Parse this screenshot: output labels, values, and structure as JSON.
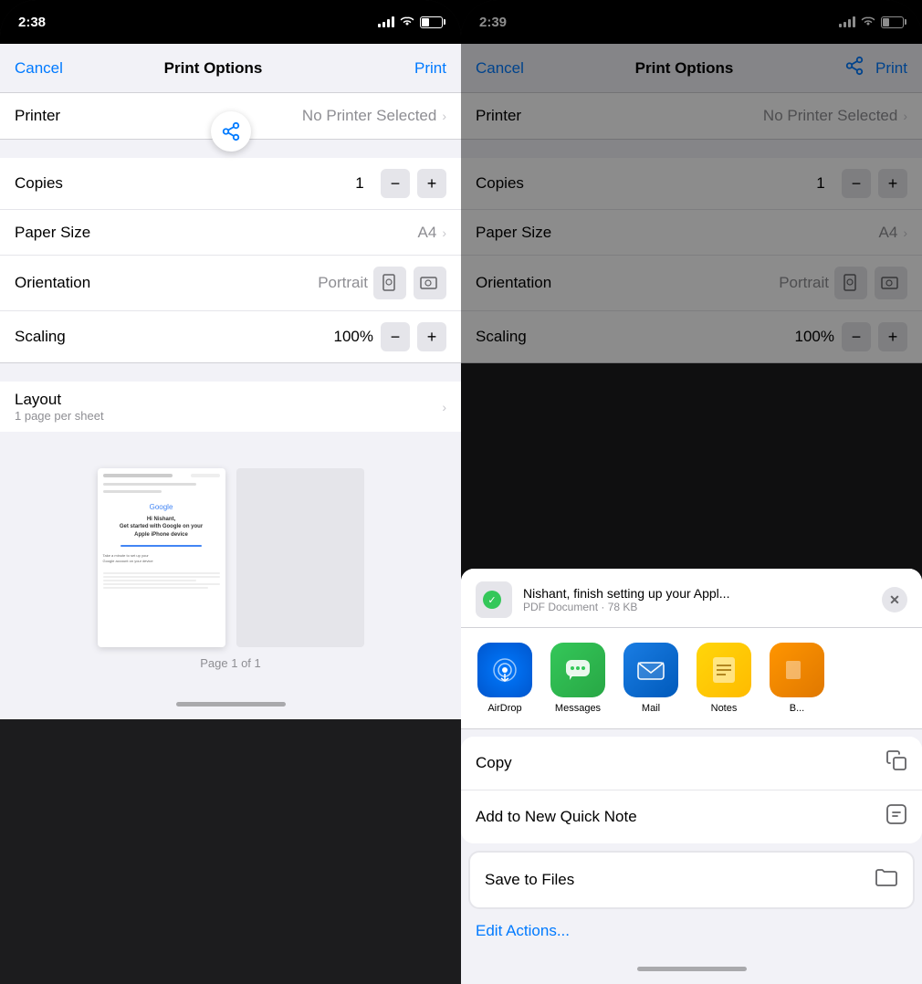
{
  "left_panel": {
    "status_bar": {
      "time": "2:38",
      "signal": "●●●",
      "wifi": "WiFi",
      "battery_pct": 40
    },
    "nav": {
      "cancel_label": "Cancel",
      "title": "Print Options",
      "print_label": "Print"
    },
    "options": {
      "printer_label": "Printer",
      "printer_value": "No Printer Selected",
      "copies_label": "Copies",
      "copies_value": "1",
      "paper_size_label": "Paper Size",
      "paper_size_value": "A4",
      "orientation_label": "Orientation",
      "orientation_value": "Portrait",
      "scaling_label": "Scaling",
      "scaling_value": "100%"
    },
    "layout": {
      "title": "Layout",
      "subtitle": "1 page per sheet"
    },
    "preview": {
      "page_label": "Page 1 of 1"
    }
  },
  "right_panel": {
    "status_bar": {
      "time": "2:39"
    },
    "nav": {
      "cancel_label": "Cancel",
      "title": "Print Options",
      "print_label": "Print"
    },
    "options": {
      "printer_label": "Printer",
      "printer_value": "No Printer Selected",
      "copies_label": "Copies",
      "copies_value": "1",
      "paper_size_label": "Paper Size",
      "paper_size_value": "A4",
      "orientation_label": "Orientation",
      "orientation_value": "Portrait",
      "scaling_label": "Scaling",
      "scaling_value": "100%"
    },
    "share_sheet": {
      "file_name": "Nishant, finish setting up your Appl...",
      "file_type": "PDF Document · 78 KB",
      "close_btn": "×",
      "apps": [
        {
          "name": "AirDrop",
          "type": "airdrop"
        },
        {
          "name": "Messages",
          "type": "messages"
        },
        {
          "name": "Mail",
          "type": "mail"
        },
        {
          "name": "Notes",
          "type": "notes"
        },
        {
          "name": "B...",
          "type": "orange"
        }
      ],
      "actions": [
        {
          "label": "Copy",
          "icon": "📄"
        },
        {
          "label": "Add to New Quick Note",
          "icon": "📋"
        }
      ],
      "save_to_files": {
        "label": "Save to Files",
        "icon": "🗂"
      },
      "edit_actions_label": "Edit Actions..."
    }
  }
}
